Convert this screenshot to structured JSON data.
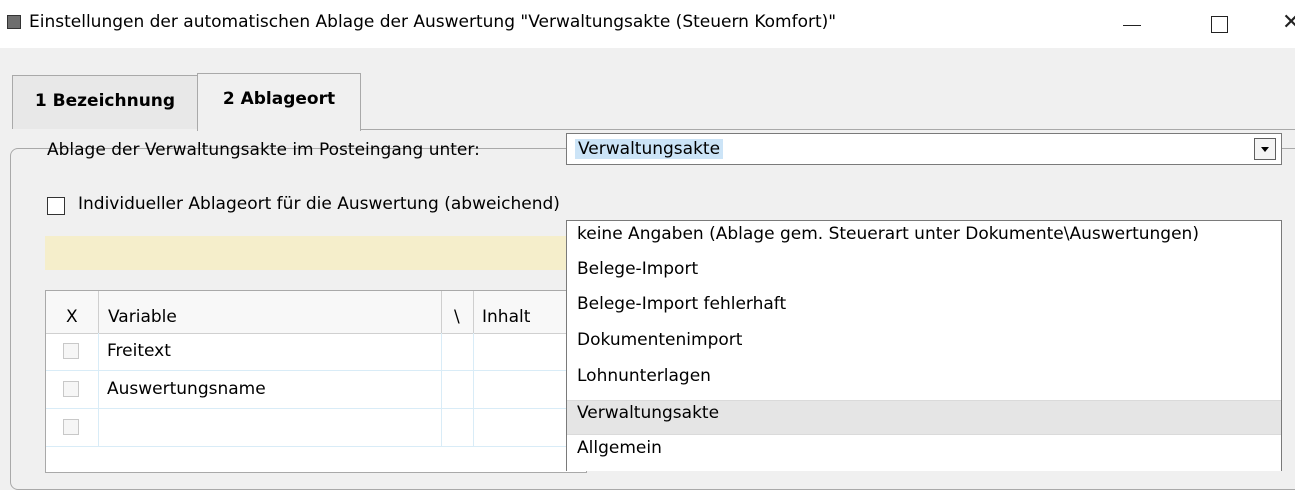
{
  "window": {
    "title": "Einstellungen der automatischen Ablage der Auswertung \"Verwaltungsakte (Steuern Komfort)\"",
    "close_glyph": "✕"
  },
  "tabs": [
    {
      "label": "1 Bezeichnung"
    },
    {
      "label": "2 Ablageort",
      "active": true
    }
  ],
  "form": {
    "ablage_label": "Ablage der Verwaltungsakte im Posteingang unter:",
    "ablage_value": "Verwaltungsakte",
    "individual_label": "Individueller Ablageort für die Auswertung (abweichend)",
    "individual_checked": false
  },
  "grid": {
    "columns": [
      "X",
      "Variable",
      "\\",
      "Inhalt"
    ],
    "rows": [
      {
        "checked": false,
        "variable": "Freitext"
      },
      {
        "checked": false,
        "variable": "Auswertungsname"
      },
      {
        "checked": false,
        "variable": ""
      }
    ]
  },
  "dropdown": {
    "options": [
      "keine Angaben (Ablage gem. Steuerart unter Dokumente\\Auswertungen)",
      "Belege-Import",
      "Belege-Import fehlerhaft",
      "Dokumentenimport",
      "Lohnunterlagen",
      "Verwaltungsakte",
      "Allgemein"
    ],
    "selected": "Verwaltungsakte"
  },
  "colors": {
    "selection": "#cce4f7",
    "hint_bar": "#f5eecb",
    "hover_item": "#e5e5e5"
  }
}
